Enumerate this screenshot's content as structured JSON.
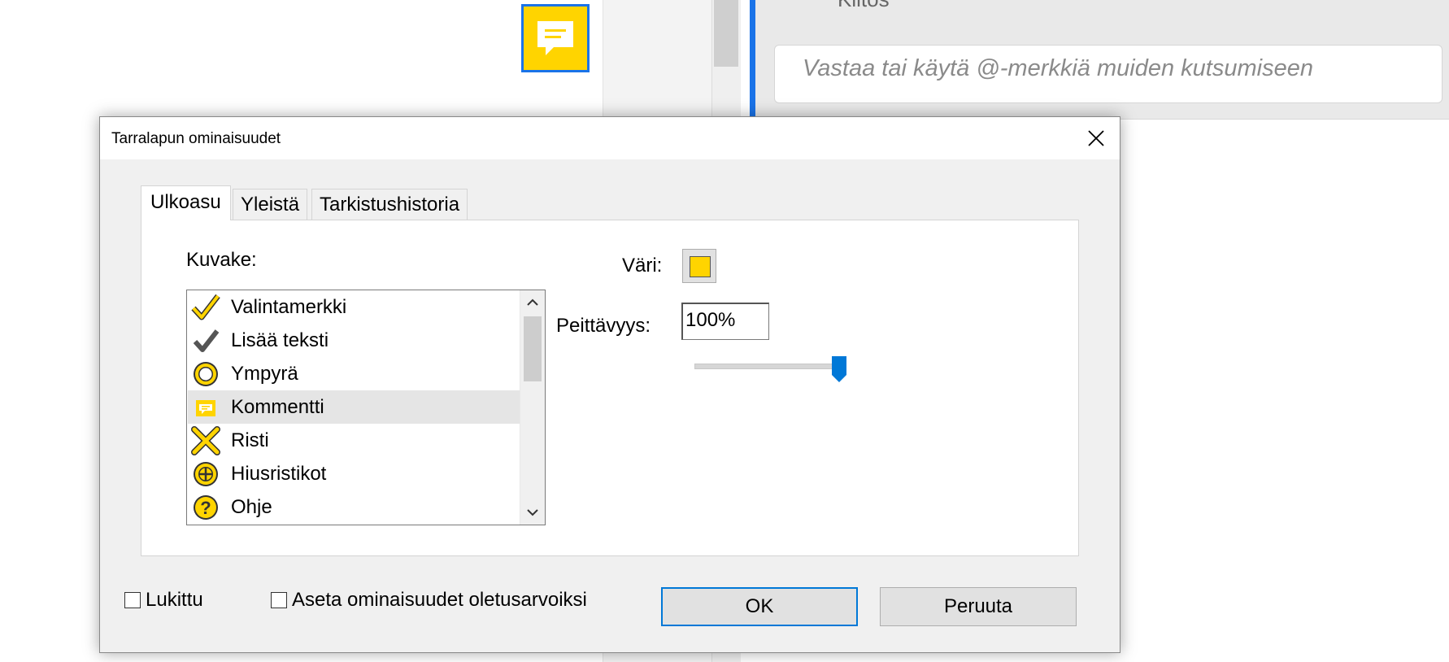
{
  "background": {
    "comment_header_text": "Kiitos",
    "reply_placeholder": "Vastaa tai käytä @-merkkiä muiden kutsumiseen",
    "sticky_note_icon": "sticky-note-icon",
    "accent_color": "#1a73e8",
    "note_color": "#ffd400"
  },
  "dialog": {
    "title": "Tarralapun ominaisuudet",
    "tabs": [
      {
        "label": "Ulkoasu",
        "active": true
      },
      {
        "label": "Yleistä",
        "active": false
      },
      {
        "label": "Tarkistushistoria",
        "active": false
      }
    ],
    "icon_label": "Kuvake:",
    "icon_list": [
      {
        "label": "Valintamerkki",
        "icon": "checkmark-icon",
        "selected": false
      },
      {
        "label": "Lisää teksti",
        "icon": "insert-text-icon",
        "selected": false
      },
      {
        "label": "Ympyrä",
        "icon": "circle-icon",
        "selected": false
      },
      {
        "label": "Kommentti",
        "icon": "comment-icon",
        "selected": true
      },
      {
        "label": "Risti",
        "icon": "cross-icon",
        "selected": false
      },
      {
        "label": "Hiusristikot",
        "icon": "crosshairs-icon",
        "selected": false
      },
      {
        "label": "Ohje",
        "icon": "help-icon",
        "selected": false
      }
    ],
    "color_label": "Väri:",
    "color_value": "#ffd400",
    "opacity_label": "Peittävyys:",
    "opacity_value": "100%",
    "opacity_slider": 1.0,
    "locked_label": "Lukittu",
    "locked_checked": false,
    "defaults_label": "Aseta ominaisuudet oletusarvoiksi",
    "defaults_checked": false,
    "ok_label": "OK",
    "cancel_label": "Peruuta"
  }
}
